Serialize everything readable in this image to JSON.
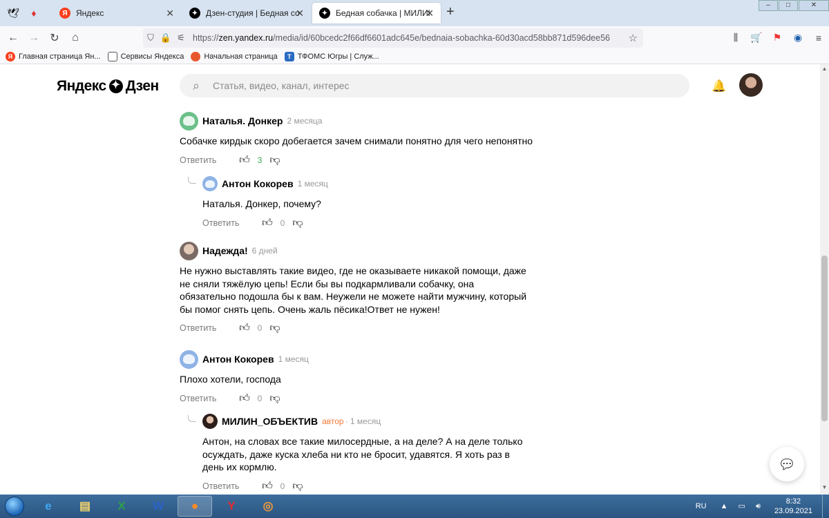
{
  "browser": {
    "tabs": [
      {
        "label": "Яндекс"
      },
      {
        "label": "Дзен-студия | Бедная собачка"
      },
      {
        "label": "Бедная собачка | МИЛИН_ОБЪ"
      }
    ],
    "new_tab": "+",
    "url_prefix": "https://",
    "url_host": "zen.yandex.ru",
    "url_path": "/media/id/60bcedc2f66df6601adc645e/bednaia-sobachka-60d30acd58bb871d596dee56",
    "bookmarks": [
      {
        "label": "Главная страница Ян..."
      },
      {
        "label": "Сервисы Яндекса"
      },
      {
        "label": "Начальная страница"
      },
      {
        "label": "ТФОМС Югры | Служ..."
      }
    ]
  },
  "site": {
    "logo_left": "Яндекс",
    "logo_right": "Дзен",
    "search_placeholder": "Статья, видео, канал, интерес"
  },
  "comments": [
    {
      "name": "Наталья. Донкер",
      "time": "2 месяца",
      "text": "Собачке кирдык скоро добегается зачем снимали понятно для чего непонятно",
      "reply": "Ответить",
      "likes": "3"
    },
    {
      "name": "Антон Кокорев",
      "time": "1 месяц",
      "text": "Наталья. Донкер, почему?",
      "reply": "Ответить",
      "likes": "0"
    },
    {
      "name": "Надежда!",
      "time": "6 дней",
      "text": "Не нужно выставлять такие видео, где не оказываете никакой помощи, даже не сняли тяжёлую цепь! Если бы вы подкармливали собачку, она обязательно подошла бы к вам. Неужели не можете найти мужчину, который бы помог снять цепь. Очень жаль пёсика!Ответ не нужен!",
      "reply": "Ответить",
      "likes": "0"
    },
    {
      "name": "Антон Кокорев",
      "time": "1 месяц",
      "text": "Плохо хотели, господа",
      "reply": "Ответить",
      "likes": "0"
    },
    {
      "name": "МИЛИН_ОБЪЕКТИВ",
      "author_tag": "автор",
      "time": "· 1 месяц",
      "text": "Антон, на словах все такие милосердные, а на деле? А на деле только осуждать, даже куска хлеба ни кто не бросит, удавятся. Я хоть раз в день их кормлю.",
      "reply": "Ответить",
      "likes": "0"
    }
  ],
  "taskbar": {
    "lang": "RU",
    "time": "8:32",
    "date": "23.09.2021"
  },
  "colors": {
    "positive_count": "#3aa84d",
    "author_tag": "#f27a3a",
    "taskbar": "#2a5580"
  }
}
